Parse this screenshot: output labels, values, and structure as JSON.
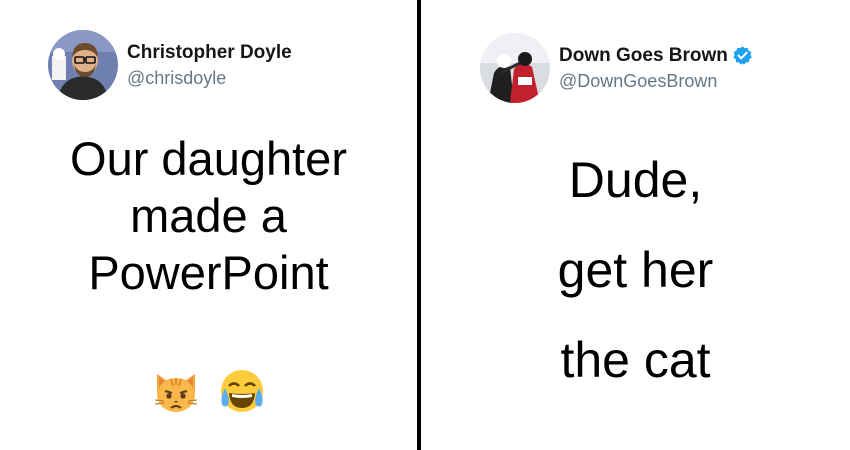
{
  "left_tweet": {
    "display_name": "Christopher Doyle",
    "handle": "@chrisdoyle",
    "text_lines": [
      "Our daughter",
      "made a",
      "PowerPoint"
    ],
    "emojis": [
      "pouting-cat-emoji",
      "tears-of-joy-emoji"
    ]
  },
  "right_tweet": {
    "display_name": "Down Goes Brown",
    "handle": "@DownGoesBrown",
    "verified": true,
    "text_lines": [
      "Dude,",
      "get her",
      "the cat"
    ]
  },
  "colors": {
    "verified_badge": "#1da1f2",
    "handle_gray": "#657786",
    "divider": "#000000"
  }
}
